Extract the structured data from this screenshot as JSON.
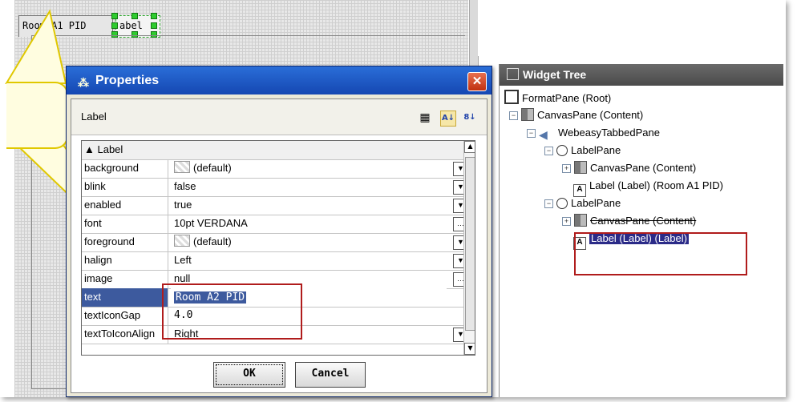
{
  "canvas": {
    "tabs": [
      {
        "label": "Room A1 PID"
      },
      {
        "label": "abel"
      }
    ]
  },
  "dialog": {
    "title": "Properties",
    "close_glyph": "✕",
    "header_label": "Label",
    "section_label": "Label",
    "rows": [
      {
        "name": "background",
        "value": "(default)",
        "button": "dropdown"
      },
      {
        "name": "blink",
        "value": "false",
        "button": "dropdown"
      },
      {
        "name": "enabled",
        "value": "true",
        "button": "dropdown"
      },
      {
        "name": "font",
        "value": "10pt VERDANA",
        "button": "ellipsis"
      },
      {
        "name": "foreground",
        "value": "(default)",
        "button": "dropdown"
      },
      {
        "name": "halign",
        "value": "Left",
        "button": "dropdown"
      },
      {
        "name": "image",
        "value": "null",
        "button": "ellipsis"
      },
      {
        "name": "text",
        "value": "Room A2 PID",
        "button": ""
      },
      {
        "name": "textIconGap",
        "value": "4.0",
        "button": ""
      },
      {
        "name": "textToIconAlign",
        "value": "Right",
        "button": "dropdown"
      }
    ],
    "ok_label": "OK",
    "cancel_label": "Cancel"
  },
  "widget_tree": {
    "title": "Widget Tree",
    "nodes": [
      {
        "label": "FormatPane (Root)"
      },
      {
        "label": "CanvasPane (Content)"
      },
      {
        "label": "WebeasyTabbedPane"
      },
      {
        "label": "LabelPane"
      },
      {
        "label": "CanvasPane (Content)"
      },
      {
        "label": "Label (Label) (Room A1 PID)"
      },
      {
        "label": "LabelPane"
      },
      {
        "label": "CanvasPane (Content)"
      },
      {
        "label": "Label (Label) (Label)"
      }
    ]
  },
  "colors": {
    "title_bar": "#1547b2",
    "tree_header": "#4a4a4a",
    "highlight_box": "#b01c1c",
    "selection": "#2b2b88",
    "callout_fill": "#fffde0",
    "callout_border": "#e0c800"
  }
}
